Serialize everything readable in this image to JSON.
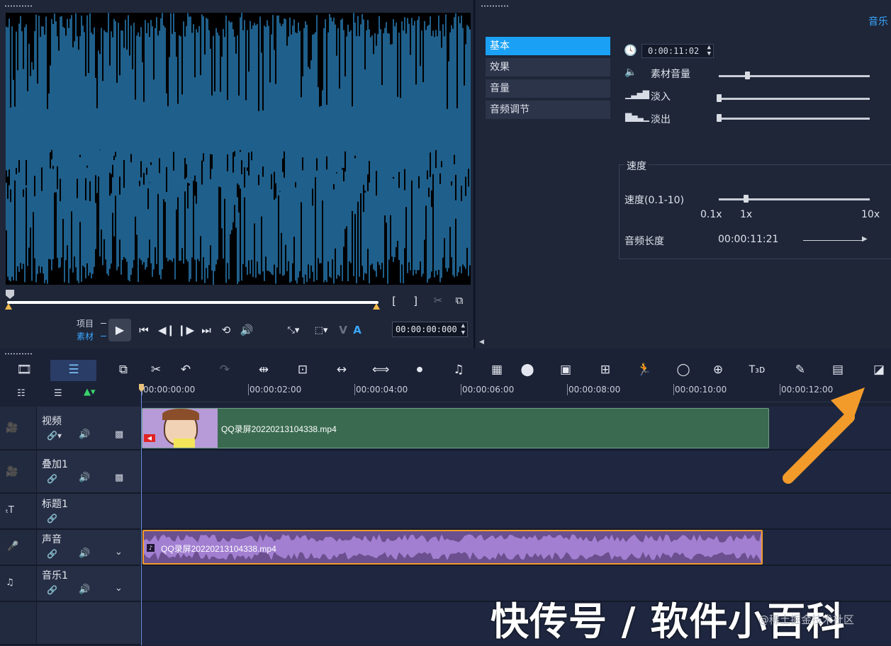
{
  "preview": {
    "mode_project": "项目",
    "mode_clip": "素材",
    "mark_in": "[",
    "mark_out": "]",
    "timecode": "00:00:00:000",
    "letter_v": "V",
    "letter_a": "A"
  },
  "options": {
    "corner_label": "音乐",
    "tabs": [
      "基本",
      "效果",
      "音量",
      "音频调节"
    ],
    "active_tab": "基本",
    "clip_duration": "0:00:11:02",
    "clip_volume_label": "素材音量",
    "fade_in_label": "淡入",
    "fade_out_label": "淡出",
    "speed_group_title": "速度",
    "speed_label": "速度(0.1-10)",
    "speed_min": "0.1x",
    "speed_mid": "1x",
    "speed_max": "10x",
    "audio_length_label": "音频长度",
    "audio_length_value": "00:00:11:21",
    "clip_volume_level": 0.19,
    "fade_in_level": 0.0,
    "fade_out_level": 0.0,
    "speed_level": 0.18
  },
  "timeline": {
    "ruler_ticks": [
      "00:00:00:00",
      "00:00:02:00",
      "00:00:04:00",
      "00:00:06:00",
      "00:00:08:00",
      "00:00:10:00",
      "00:00:12:00"
    ],
    "tracks": [
      {
        "name": "视频",
        "icon": "video-track-icon"
      },
      {
        "name": "叠加1",
        "icon": "overlay-track-icon"
      },
      {
        "name": "标题1",
        "icon": "title-track-icon"
      },
      {
        "name": "声音",
        "icon": "voice-track-icon"
      },
      {
        "name": "音乐1",
        "icon": "music-track-icon"
      }
    ],
    "video_clip_name": "QQ录屏20220213104338.mp4",
    "audio_clip_name": "QQ录屏20220213104338.mp4"
  },
  "watermark": {
    "text": "快传号 / 软件小百科",
    "small": "@稀土掘金技术社区"
  },
  "colors": {
    "accent": "#1aa1f5",
    "video_clip": "#3a6b50",
    "audio_clip": "#a27fd1",
    "waveform": "#1f5f8b",
    "arrow": "#f39b2a"
  }
}
